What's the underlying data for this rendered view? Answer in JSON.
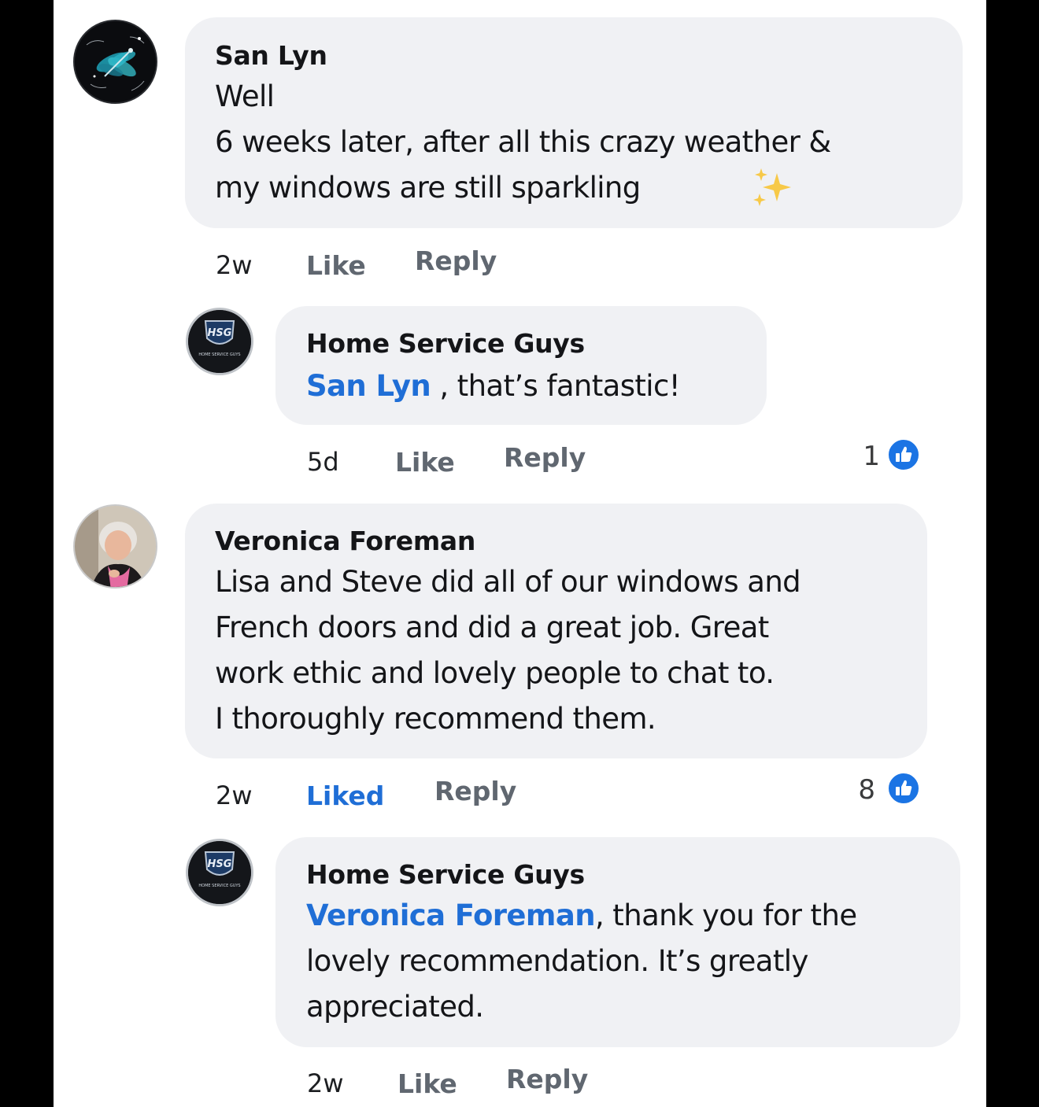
{
  "comments": [
    {
      "author": "San Lyn",
      "lines": [
        "Well",
        "6 weeks later, after all this crazy weather &",
        "my windows are still sparkling"
      ],
      "emoji": "✨",
      "time": "2w",
      "like_label": "Like",
      "reply_label": "Reply",
      "reply": {
        "author": "Home Service Guys",
        "mention": "San Lyn",
        "line1_rest": " , that’s fantastic!",
        "time": "5d",
        "like_label": "Like",
        "reply_label": "Reply",
        "reaction_count": "1"
      }
    },
    {
      "author": "Veronica Foreman",
      "lines": [
        "Lisa and Steve did all of our windows and",
        "French doors and did a great job. Great",
        "work ethic and lovely people to chat to.",
        "I thoroughly recommend them."
      ],
      "time": "2w",
      "like_label": "Liked",
      "reply_label": "Reply",
      "reaction_count": "8",
      "reply": {
        "author": "Home Service Guys",
        "mention": "Veronica Foreman",
        "line1_rest": ", thank you for the",
        "lines_after": [
          "lovely recommendation. It’s greatly",
          "appreciated."
        ],
        "time": "2w",
        "like_label": "Like",
        "reply_label": "Reply"
      }
    }
  ],
  "logo_text": {
    "initials": "HSG",
    "name": "HOME SERVICE GUYS"
  },
  "colors": {
    "bubble": "#f0f1f4",
    "link_blue": "#1f6ed6",
    "like_badge": "#1b74e4",
    "meta_gray": "#606770"
  }
}
